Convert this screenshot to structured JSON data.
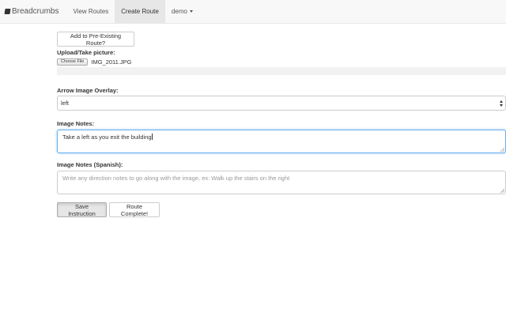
{
  "navbar": {
    "brand": "Breadcrumbs",
    "items": [
      {
        "label": "View Routes",
        "active": false
      },
      {
        "label": "Create Route",
        "active": true
      }
    ],
    "user_menu": "demo"
  },
  "form": {
    "add_existing_button": "Add to Pre-Existing Route?",
    "upload_label": "Upload/Take picture:",
    "file_button": "Choose File",
    "file_name": "IMG_2011.JPG",
    "overlay_label": "Arrow Image Overlay:",
    "overlay_value": "left",
    "notes_label": "Image Notes:",
    "notes_value": "Take a left as you exit the building",
    "notes_es_label": "Image Notes (Spanish):",
    "notes_es_placeholder": "Write any direction notes to go along with the image, ex: Walk up the stairs on the right",
    "save_button": "Save Instruction",
    "complete_button": "Route Complete!"
  }
}
